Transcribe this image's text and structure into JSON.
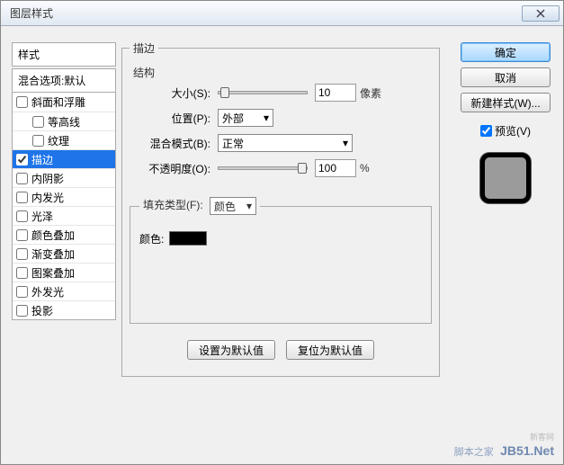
{
  "titlebar": {
    "title": "图层样式"
  },
  "left": {
    "style_header": "样式",
    "blend_default": "混合选项:默认",
    "items": [
      {
        "label": "斜面和浮雕",
        "checked": false,
        "indent": false
      },
      {
        "label": "等高线",
        "checked": false,
        "indent": true
      },
      {
        "label": "纹理",
        "checked": false,
        "indent": true
      },
      {
        "label": "描边",
        "checked": true,
        "indent": false,
        "selected": true
      },
      {
        "label": "内阴影",
        "checked": false,
        "indent": false
      },
      {
        "label": "内发光",
        "checked": false,
        "indent": false
      },
      {
        "label": "光泽",
        "checked": false,
        "indent": false
      },
      {
        "label": "颜色叠加",
        "checked": false,
        "indent": false
      },
      {
        "label": "渐变叠加",
        "checked": false,
        "indent": false
      },
      {
        "label": "图案叠加",
        "checked": false,
        "indent": false
      },
      {
        "label": "外发光",
        "checked": false,
        "indent": false
      },
      {
        "label": "投影",
        "checked": false,
        "indent": false
      }
    ]
  },
  "center": {
    "group_title": "描边",
    "structure_title": "结构",
    "size_label": "大小(S):",
    "size_value": "10",
    "size_unit": "像素",
    "position_label": "位置(P):",
    "position_value": "外部",
    "blendmode_label": "混合模式(B):",
    "blendmode_value": "正常",
    "opacity_label": "不透明度(O):",
    "opacity_value": "100",
    "opacity_unit": "%",
    "filltype_title_label": "填充类型(F):",
    "filltype_value": "颜色",
    "color_label": "颜色:",
    "color_value": "#000000",
    "btn_default": "设置为默认值",
    "btn_reset": "复位为默认值"
  },
  "right": {
    "ok": "确定",
    "cancel": "取消",
    "newstyle": "新建样式(W)...",
    "preview_label": "预览(V)",
    "preview_checked": true
  },
  "watermark": {
    "xinke": "新客网",
    "cn": "脚本之家",
    "en": "JB51.Net"
  }
}
